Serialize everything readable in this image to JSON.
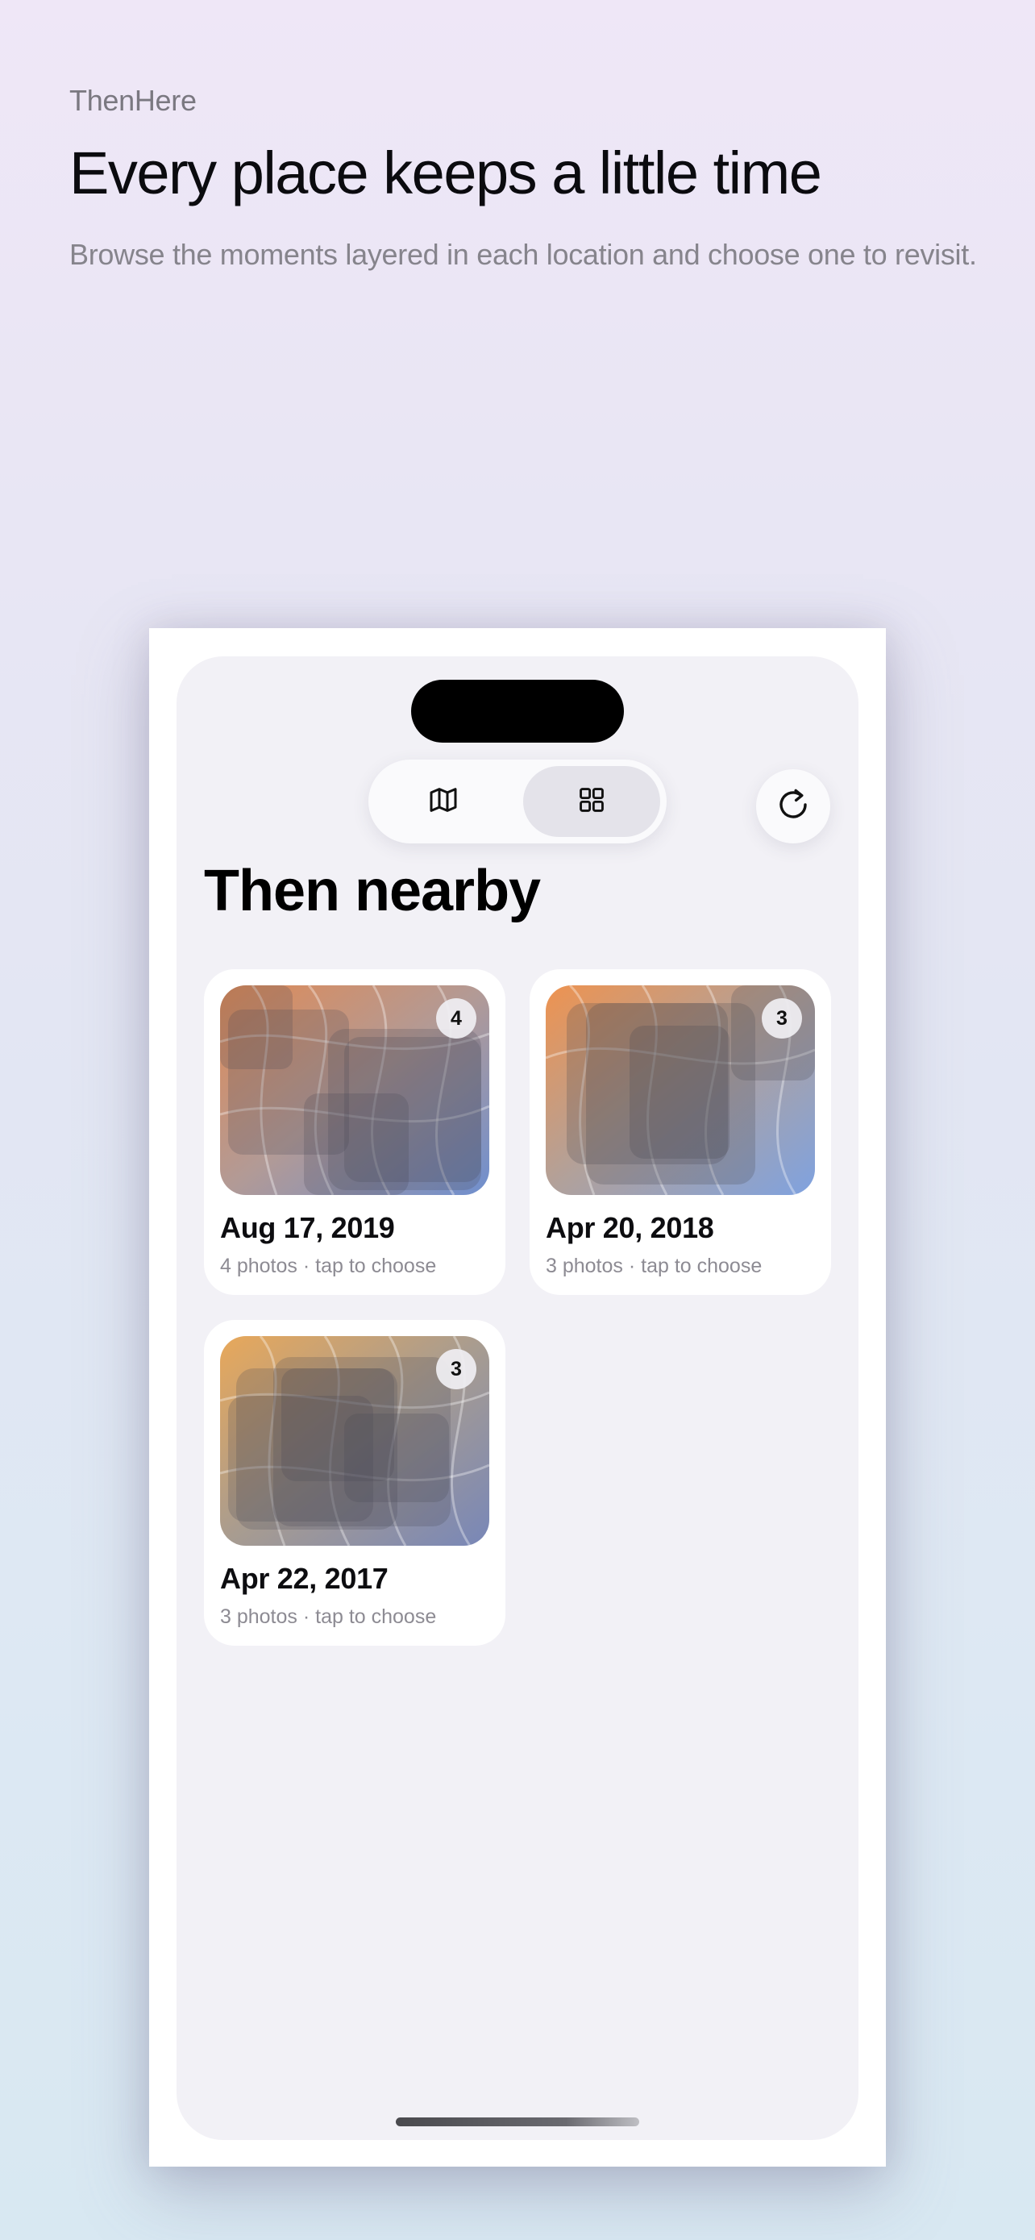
{
  "intro": {
    "app_name": "ThenHere",
    "headline": "Every place keeps a little time",
    "subline": "Browse the moments layered in each location and choose one to revisit."
  },
  "toolbar": {
    "view_modes": [
      {
        "icon": "map-icon",
        "selected": false
      },
      {
        "icon": "grid-icon",
        "selected": true
      }
    ],
    "refresh_icon": "refresh-icon"
  },
  "section_title": "Then nearby",
  "cards": [
    {
      "date": "Aug 17, 2019",
      "count": "4",
      "meta": "4 photos · tap to choose"
    },
    {
      "date": "Apr 20, 2018",
      "count": "3",
      "meta": "3 photos · tap to choose"
    },
    {
      "date": "Apr 22, 2017",
      "count": "3",
      "meta": "3 photos · tap to choose"
    }
  ],
  "colors": {
    "accent_orange": "#e8915a",
    "accent_blue": "#7e9fd8",
    "screen_bg": "#f2f1f6"
  }
}
